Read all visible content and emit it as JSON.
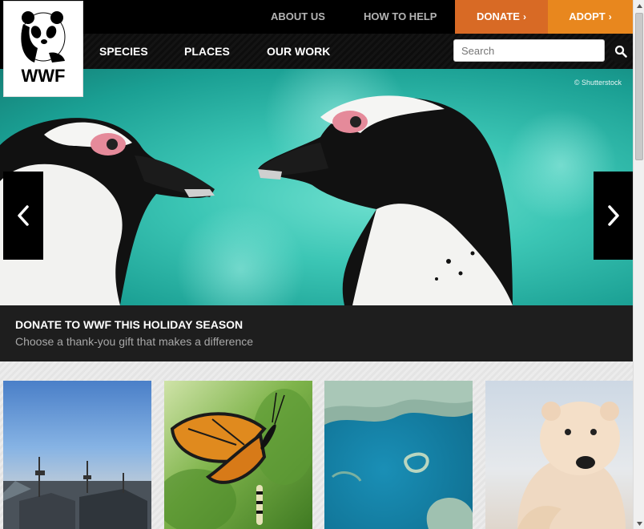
{
  "logo": {
    "text": "WWF"
  },
  "topnav": {
    "about": "ABOUT US",
    "how_to_help": "HOW TO HELP",
    "donate": "DONATE",
    "adopt": "ADOPT",
    "chevron": "›"
  },
  "mainnav": {
    "species": "SPECIES",
    "places": "PLACES",
    "our_work": "OUR WORK"
  },
  "search": {
    "placeholder": "Search"
  },
  "hero": {
    "credit": "© Shutterstock",
    "caption_title": "DONATE TO WWF THIS HOLIDAY SEASON",
    "caption_subtitle": "Choose a thank-you gift that makes a difference"
  },
  "tiles": [
    {
      "subject": "harbor-boats"
    },
    {
      "subject": "monarch-butterfly"
    },
    {
      "subject": "coral-reef-aerial"
    },
    {
      "subject": "polar-bear"
    }
  ],
  "colors": {
    "donate": "#d86a25",
    "adopt": "#e8871e",
    "header": "#000000",
    "caption": "#1e1e1e"
  }
}
